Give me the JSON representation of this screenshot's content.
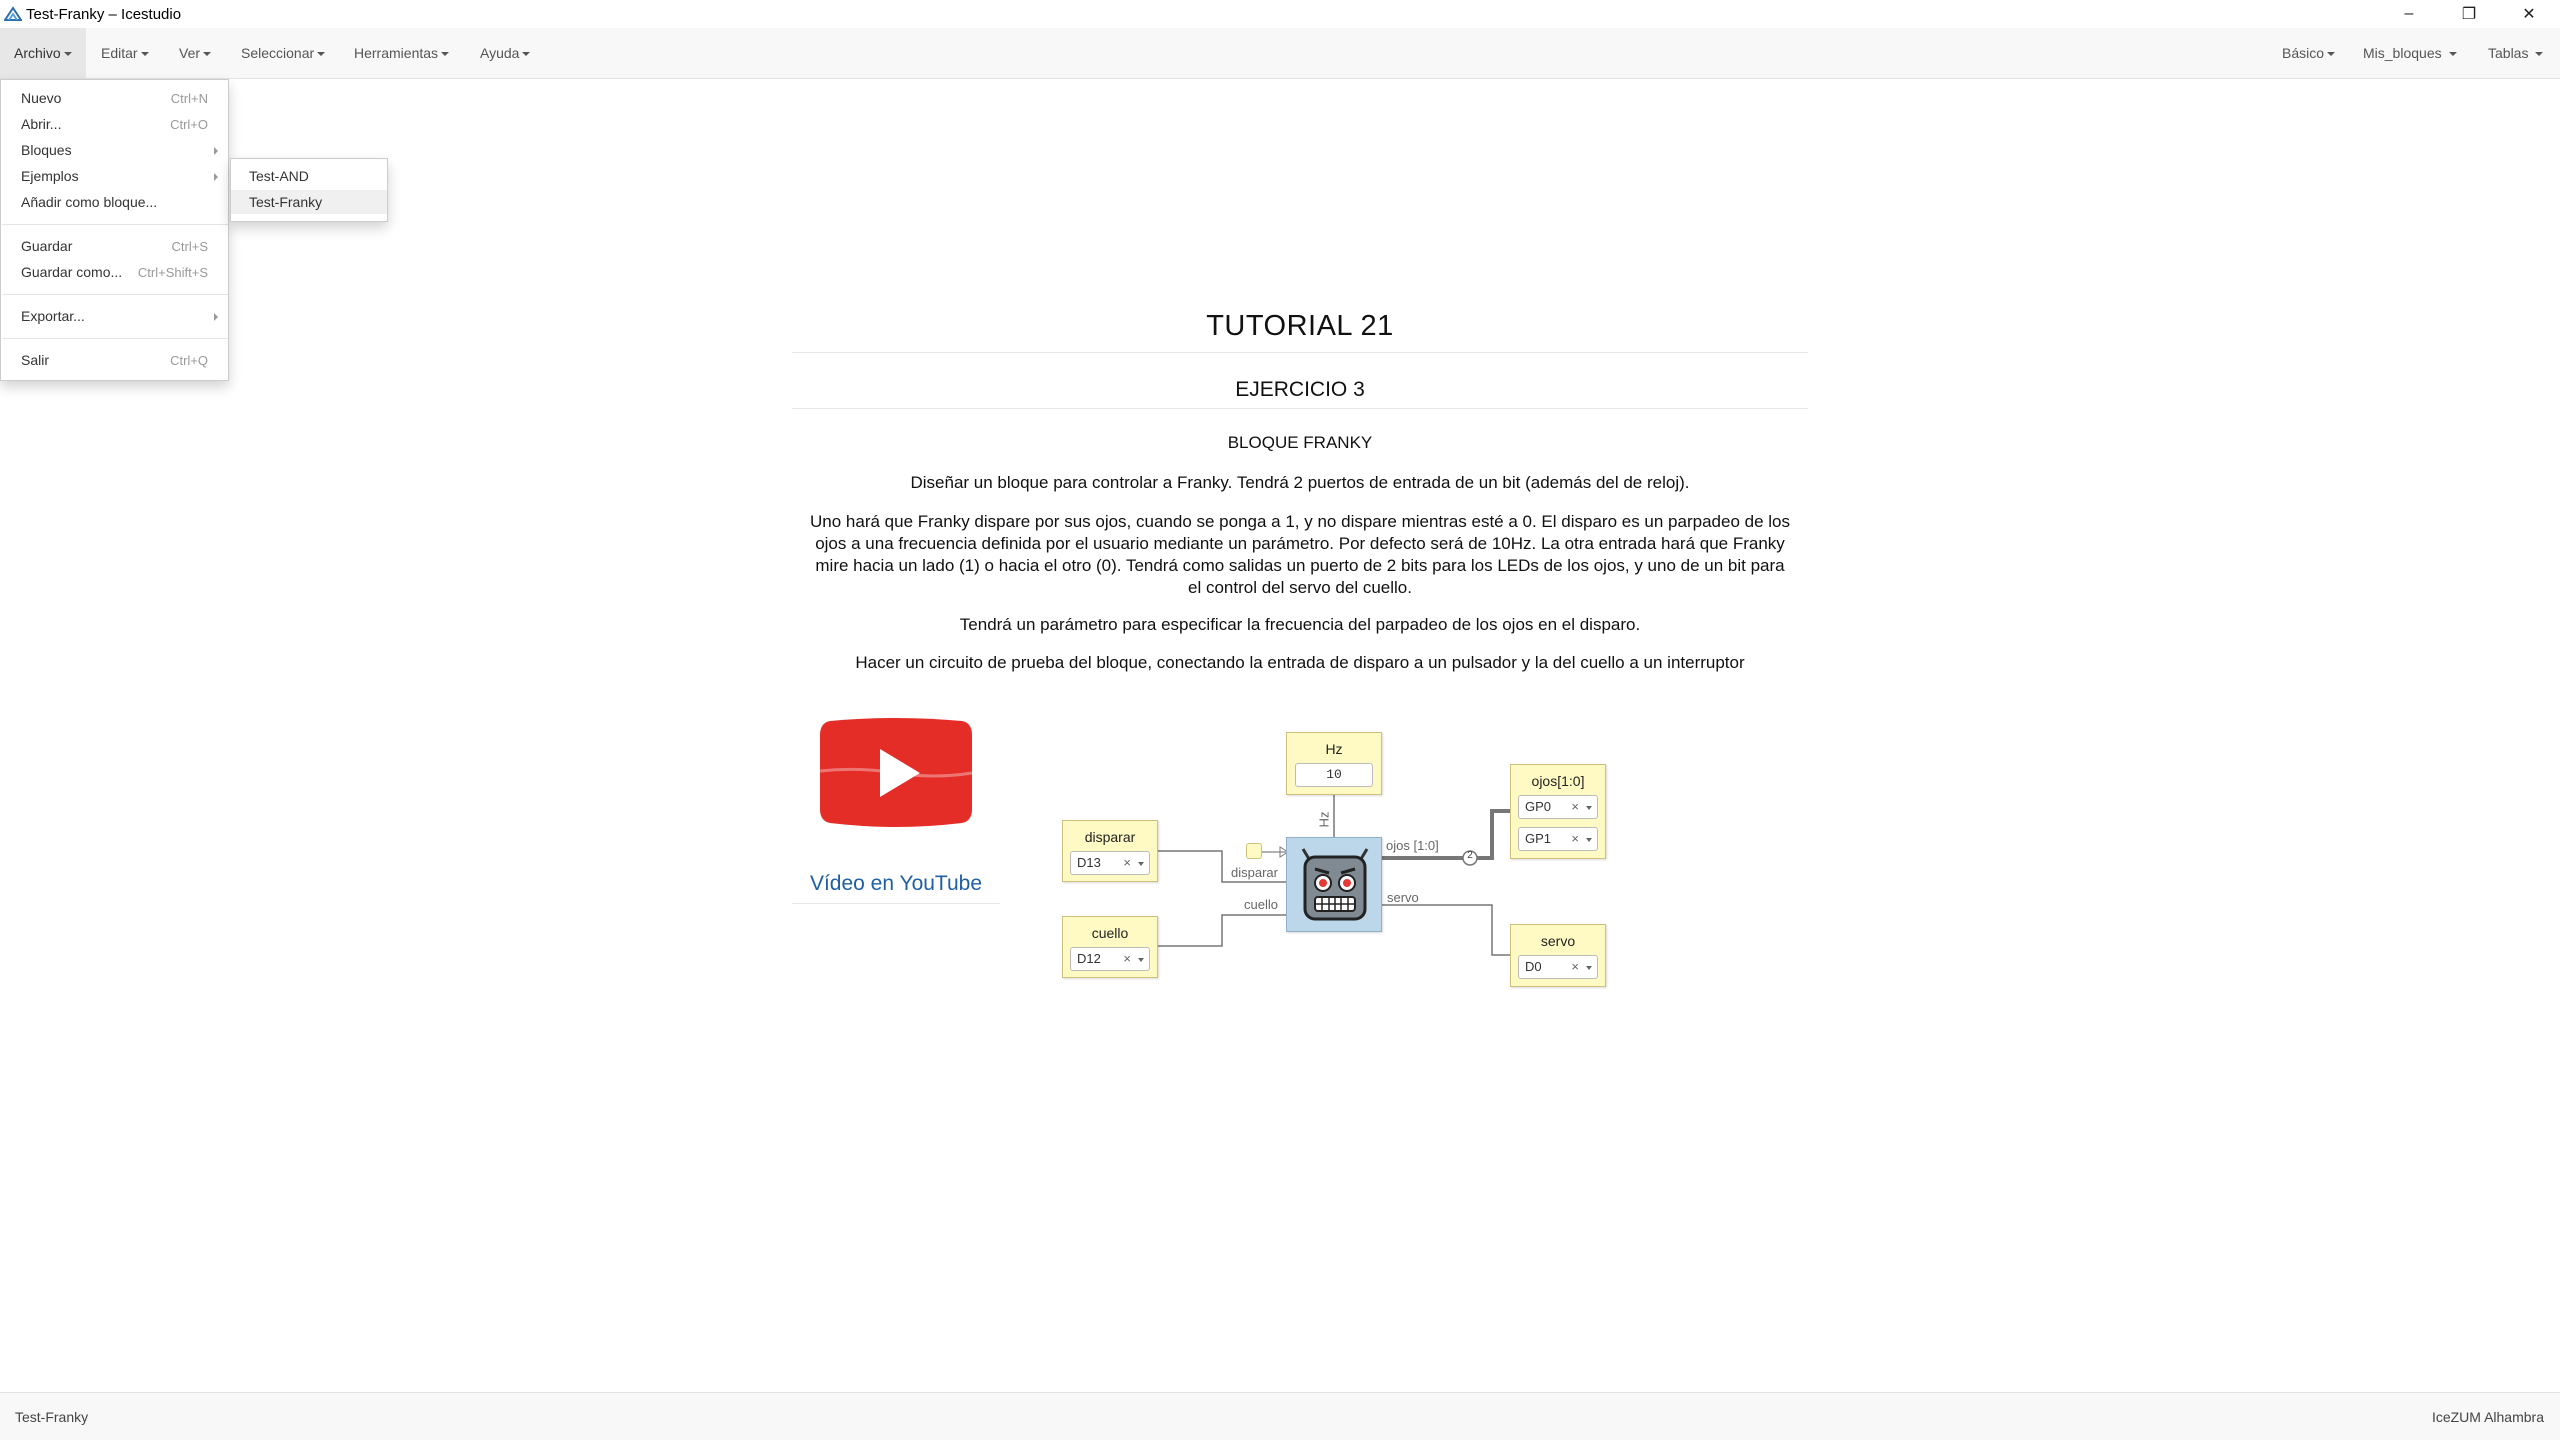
{
  "window": {
    "title": "Test-Franky – Icestudio",
    "minimize": "–",
    "restore": "❐",
    "close": "✕"
  },
  "menubar": {
    "left": [
      "Archivo",
      "Editar",
      "Ver",
      "Seleccionar",
      "Herramientas",
      "Ayuda"
    ],
    "right": [
      "Básico",
      "Mis_bloques",
      "Tablas"
    ]
  },
  "file_menu": {
    "items": [
      {
        "label": "Nuevo",
        "shortcut": "Ctrl+N"
      },
      {
        "label": "Abrir...",
        "shortcut": "Ctrl+O"
      },
      {
        "label": "Bloques",
        "shortcut": ""
      },
      {
        "label": "Ejemplos",
        "shortcut": ""
      },
      {
        "label": "Añadir como bloque...",
        "shortcut": ""
      },
      {
        "label": "Guardar",
        "shortcut": "Ctrl+S"
      },
      {
        "label": "Guardar como...",
        "shortcut": "Ctrl+Shift+S"
      },
      {
        "label": "Exportar...",
        "shortcut": ""
      },
      {
        "label": "Salir",
        "shortcut": "Ctrl+Q"
      }
    ]
  },
  "examples_submenu": {
    "items": [
      "Test-AND",
      "Test-Franky"
    ]
  },
  "info": {
    "title": "TUTORIAL 21",
    "exercise": "EJERCICIO 3",
    "block": "BLOQUE FRANKY",
    "p1": "Diseñar un bloque para controlar a Franky. Tendrá 2 puertos de entrada de un bit (además del de reloj).",
    "p2_l1": "Uno hará que Franky dispare por sus ojos, cuando se ponga a 1, y no dispare mientras esté a 0. El disparo es un parpadeo de los",
    "p2_l2": "ojos a una frecuencia definida por el usuario mediante un parámetro. Por defecto será de 10Hz. La otra entrada hará que Franky",
    "p2_l3": "mire hacia un lado (1) o hacia el otro (0). Tendrá como salidas un puerto de 2 bits para los LEDs de los ojos, y uno de un bit para",
    "p2_l4": "el control del servo del cuello.",
    "p3": "Tendrá un parámetro para especificar la frecuencia del parpadeo de los ojos en el disparo.",
    "p4": "Hacer un circuito de prueba del bloque, conectando la entrada de disparo a un pulsador y la del cuello a un interruptor"
  },
  "video": {
    "link_text": "Vídeo en YouTube",
    "colors": {
      "logo": "#e52d27"
    }
  },
  "circuit": {
    "constant": {
      "label": "Hz",
      "value": "10"
    },
    "inputs": [
      {
        "label": "disparar",
        "pin": "D13"
      },
      {
        "label": "cuello",
        "pin": "D12"
      }
    ],
    "outputs": [
      {
        "label": "ojos[1:0]",
        "pins": [
          "GP0",
          "GP1"
        ]
      },
      {
        "label": "servo",
        "pin": "D0"
      }
    ],
    "wire_labels": {
      "hz": "Hz",
      "disparar": "disparar",
      "cuello": "cuello",
      "ojos": "ojos [1:0]",
      "servo": "servo",
      "bus_width": "2"
    },
    "clear_mark": "×",
    "colors": {
      "block_fill": "#bcd7ea",
      "port_fill": "#fff9c4"
    }
  },
  "statusbar": {
    "left": "Test-Franky",
    "right": "IceZUM Alhambra"
  }
}
